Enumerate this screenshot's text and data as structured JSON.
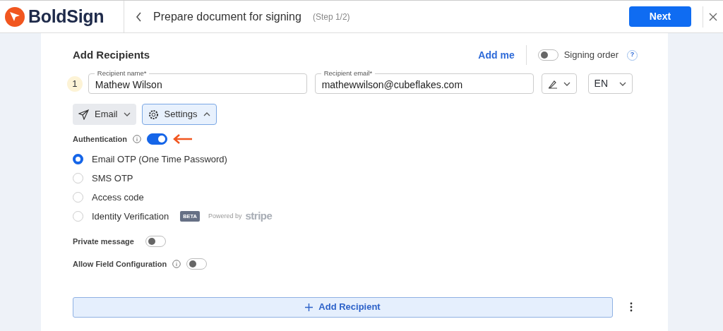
{
  "header": {
    "logo": "BoldSign",
    "title": "Prepare document for signing",
    "step": "(Step 1/2)",
    "next_button": "Next"
  },
  "recipients": {
    "title": "Add Recipients",
    "add_me": "Add me",
    "signing_order": {
      "label": "Signing order",
      "on": false
    },
    "help": "?",
    "recipient": {
      "number": "1",
      "name_field": {
        "label": "Recipient name*",
        "value": "Mathew Wilson"
      },
      "email_field": {
        "label": "Recipient email*",
        "value": "mathewwilson@cubeflakes.com"
      },
      "language": "EN",
      "delivery_button": "Email",
      "settings_button": {
        "label": "Settings",
        "expanded": true
      },
      "authentication": {
        "label": "Authentication",
        "on": true
      },
      "options": [
        {
          "label": "Email OTP (One Time Password)",
          "selected": true
        },
        {
          "label": "SMS OTP",
          "selected": false
        },
        {
          "label": "Access code",
          "selected": false
        },
        {
          "label": "Identity Verification",
          "selected": false,
          "badge": "BETA",
          "powered_by": "Powered by",
          "provider": "stripe"
        }
      ],
      "private_message": {
        "label": "Private message",
        "on": false
      },
      "allow_field_configuration": {
        "label": "Allow Field Configuration",
        "on": false
      }
    },
    "add_recipient_button": "Add Recipient"
  }
}
